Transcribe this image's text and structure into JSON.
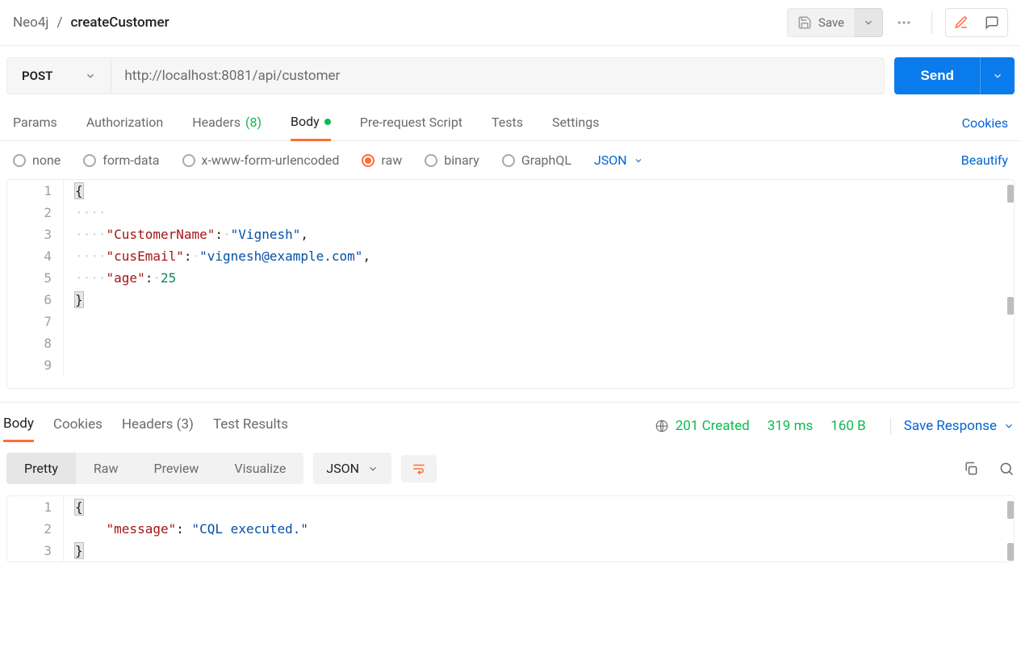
{
  "breadcrumb": {
    "collection": "Neo4j",
    "request": "createCustomer"
  },
  "topActions": {
    "saveLabel": "Save"
  },
  "request": {
    "method": "POST",
    "url": "http://localhost:8081/api/customer",
    "sendLabel": "Send"
  },
  "reqTabs": {
    "params": "Params",
    "auth": "Authorization",
    "headers": "Headers",
    "headersCount": "(8)",
    "body": "Body",
    "prereq": "Pre-request Script",
    "tests": "Tests",
    "settings": "Settings",
    "cookies": "Cookies"
  },
  "bodyTypes": {
    "none": "none",
    "formdata": "form-data",
    "urlencoded": "x-www-form-urlencoded",
    "raw": "raw",
    "binary": "binary",
    "graphql": "GraphQL",
    "format": "JSON",
    "beautify": "Beautify"
  },
  "reqBody": {
    "lines": [
      "1",
      "2",
      "3",
      "4",
      "5",
      "6",
      "7",
      "8",
      "9"
    ],
    "l1": "{",
    "l3_key": "\"CustomerName\"",
    "l3_val": "\"Vignesh\"",
    "l4_key": "\"cusEmail\"",
    "l4_val": "\"vignesh@example.com\"",
    "l5_key": "\"age\"",
    "l5_val": "25",
    "l6": "}"
  },
  "respTabs": {
    "body": "Body",
    "cookies": "Cookies",
    "headers": "Headers",
    "headersCount": "(3)",
    "testResults": "Test Results"
  },
  "respMeta": {
    "status": "201 Created",
    "time": "319 ms",
    "size": "160 B",
    "save": "Save Response"
  },
  "respCtrl": {
    "pretty": "Pretty",
    "raw": "Raw",
    "preview": "Preview",
    "visualize": "Visualize",
    "format": "JSON"
  },
  "respBody": {
    "lines": [
      "1",
      "2",
      "3"
    ],
    "l1": "{",
    "l2_key": "\"message\"",
    "l2_val": "\"CQL executed.\"",
    "l3": "}"
  }
}
